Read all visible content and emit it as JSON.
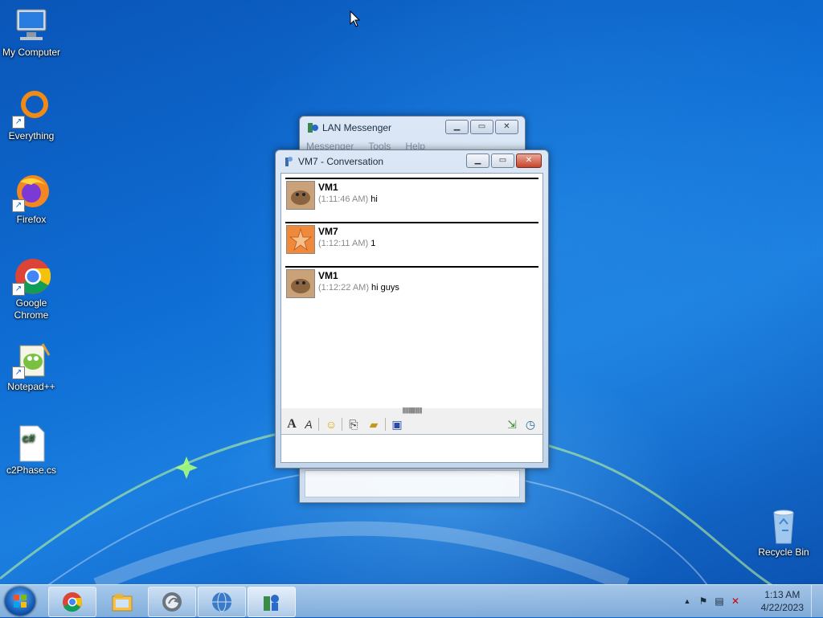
{
  "desktop_icons": [
    {
      "label": "My Computer"
    },
    {
      "label": "Everything"
    },
    {
      "label": "Firefox"
    },
    {
      "label": "Google Chrome"
    },
    {
      "label": "Notepad++"
    },
    {
      "label": "c2Phase.cs"
    },
    {
      "label": "Recycle Bin"
    }
  ],
  "back_window": {
    "title": "LAN Messenger",
    "menu": [
      "Messenger",
      "Tools",
      "Help"
    ]
  },
  "conversation": {
    "title": "VM7 - Conversation",
    "messages": [
      {
        "name": "VM1",
        "time": "(1:11:46 AM)",
        "text": "hi"
      },
      {
        "name": "VM7",
        "time": "(1:12:11 AM)",
        "text": "1"
      },
      {
        "name": "VM1",
        "time": "(1:12:22 AM)",
        "text": "hi guys"
      }
    ],
    "input_value": "",
    "toolbar_icons": [
      "font-icon",
      "font-style-icon",
      "smiley-icon",
      "attach-file-icon",
      "send-folder-icon",
      "save-icon",
      "export-icon",
      "history-icon"
    ]
  },
  "taskbar": {
    "pinned": [
      "chrome-icon",
      "explorer-icon",
      "app-icon",
      "network-icon",
      "lan-messenger-icon"
    ]
  },
  "tray": {
    "time": "1:13 AM",
    "date": "4/22/2023"
  },
  "colors": {
    "desktop": "#0f6ed4",
    "close_button": "#c7452c"
  }
}
